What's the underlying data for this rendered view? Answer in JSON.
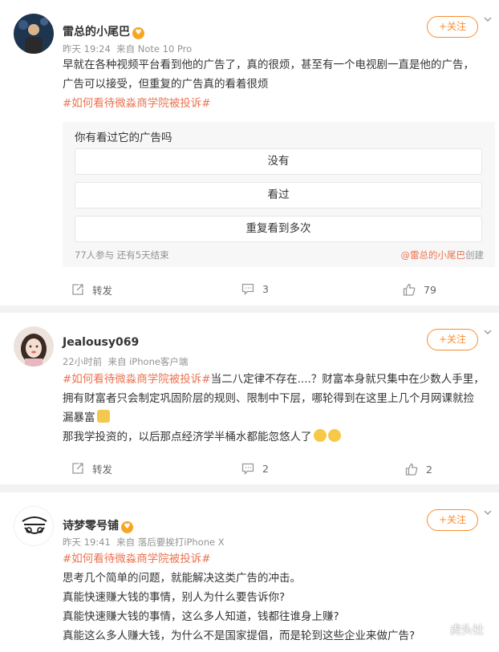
{
  "posts": [
    {
      "username": "雷总的小尾巴",
      "time": "昨天 19:24",
      "source": "来自 Note 10 Pro",
      "follow_label": "+关注",
      "text_line1": "早就在各种视频平台看到他的广告了，真的很烦，甚至有一个电视剧一直是他的广告，",
      "text_line2": "广告可以接受，但重复的广告真的看着很烦",
      "hashtag": "#如何看待微淼商学院被投诉#",
      "poll": {
        "question": "你有看过它的广告吗",
        "options": [
          "没有",
          "看过",
          "重复看到多次"
        ],
        "footer": "77人参与 还有5天结束",
        "creator_link": "@雷总的小尾巴",
        "creator_suffix": "创建"
      },
      "actions": {
        "repost": "转发",
        "comments": "3",
        "likes": "79"
      }
    },
    {
      "username": "Jealousy069",
      "time": "22小时前",
      "source": "来自 iPhone客户端",
      "follow_label": "+关注",
      "hashtag": "#如何看待微淼商学院被投诉#",
      "text_line1": "当二八定律不存在....？财富本身就只集中在少数人手里，",
      "text_line2": "拥有财富者只会制定巩固阶层的规则、限制中下层，哪轮得到在这里上几个月网课就捡",
      "text_line3": "漏暴富",
      "text_line4": "那我学投资的，以后那点经济学半桶水都能忽悠人了",
      "actions": {
        "repost": "转发",
        "comments": "2",
        "likes": "2"
      }
    },
    {
      "username": "诗梦零号铺",
      "time": "昨天 19:41",
      "source": "来自 落后要挨打iPhone X",
      "follow_label": "+关注",
      "hashtag": "#如何看待微淼商学院被投诉#",
      "lines": [
        "思考几个简单的问题，就能解决这类广告的冲击。",
        "真能快速赚大钱的事情，别人为什么要告诉你?",
        "真能快速赚大钱的事情，这么多人知道，钱都往谁身上赚?",
        "真能这么多人赚大钱，为什么不是国家提倡，而是轮到这些企业来做广告?"
      ]
    }
  ],
  "watermark": "虎头社",
  "colors": {
    "accent": "#f98c30",
    "hashtag": "#eb7350",
    "meta": "#939393"
  }
}
